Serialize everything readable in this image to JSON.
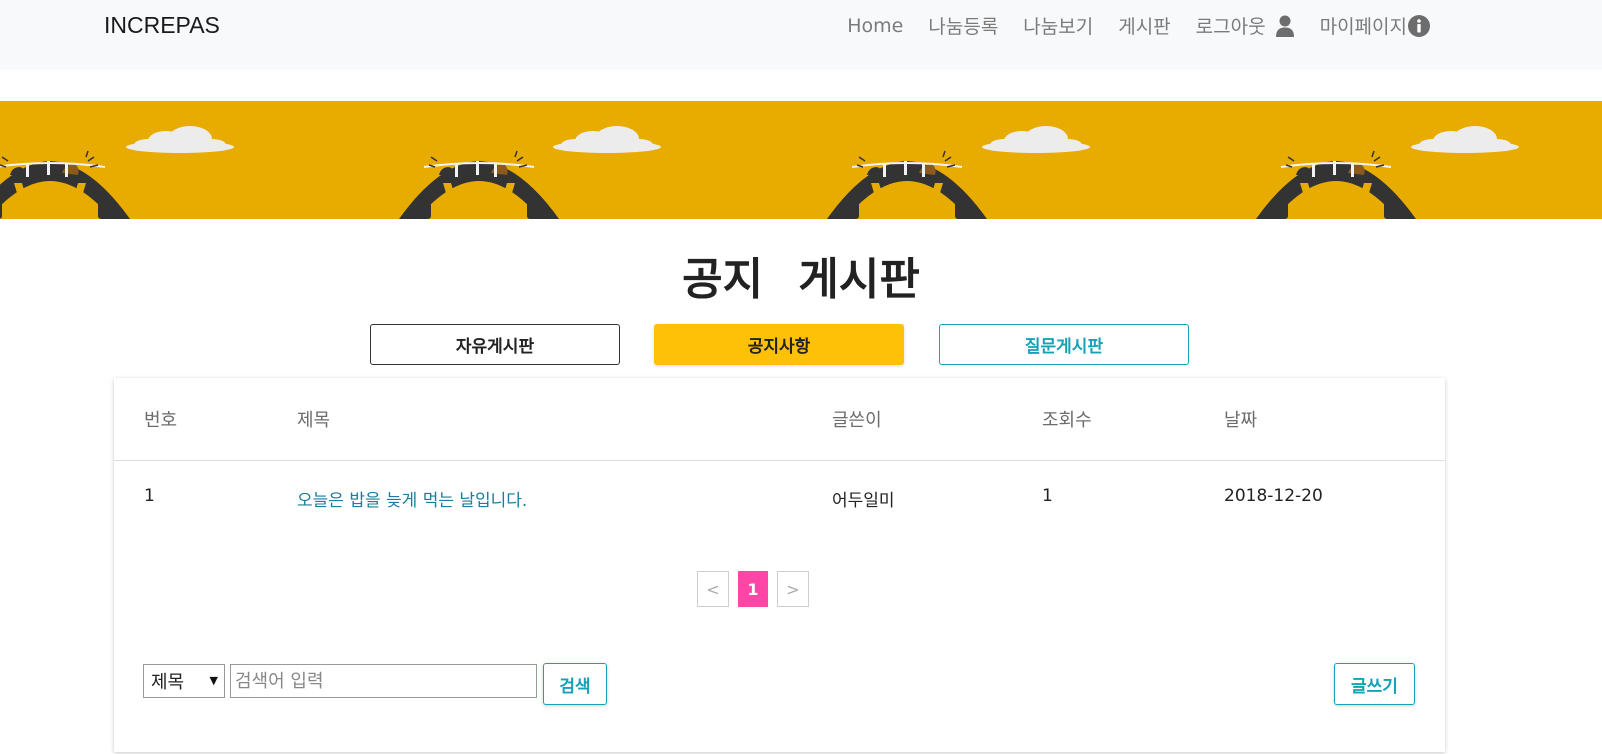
{
  "brand": "INCREPAS",
  "nav": {
    "home": "Home",
    "share_register": "나눔등록",
    "share_view": "나눔보기",
    "board": "게시판",
    "logout": "로그아웃",
    "mypage": "마이페이지",
    "logout_icon": "user-icon",
    "mypage_icon": "info-circle-icon"
  },
  "page_title": "공지 게시판",
  "tabs": {
    "free": "자유게시판",
    "notice": "공지사항",
    "question": "질문게시판",
    "active": "notice"
  },
  "table": {
    "headers": {
      "num": "번호",
      "title": "제목",
      "author": "글쓴이",
      "views": "조회수",
      "date": "날짜"
    },
    "rows": [
      {
        "num": "1",
        "title": "오늘은 밥을 늦게 먹는 날입니다.",
        "author": "어두일미",
        "views": "1",
        "date": "2018-12-20"
      }
    ]
  },
  "pagination": {
    "prev": "<",
    "current": "1",
    "next": ">"
  },
  "search": {
    "field_selected": "제목",
    "placeholder": "검색어 입력",
    "button": "검색"
  },
  "write_button": "글쓰기",
  "colors": {
    "banner": "#e8ab00",
    "notice_tab": "#ffc107",
    "accent_teal": "#17a2b8",
    "page_active": "#ff45a5"
  }
}
